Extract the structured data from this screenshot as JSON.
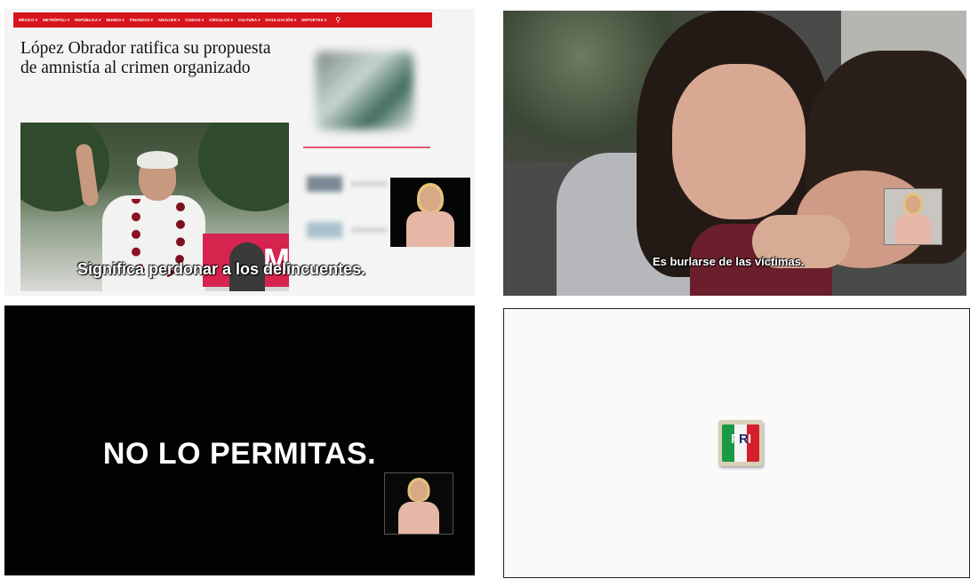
{
  "frame1": {
    "nav_items": [
      "MÉXICO ▾",
      "METRÓPOLI ▾",
      "REPÚBLICA ▾",
      "MUNDO ▾",
      "FINANZAS ▾",
      "ANÁLISIS ▾",
      "CIUDAD ▾",
      "CÍRCULOS ▾",
      "CULTURA ▾",
      "DIVULGACIÓN ▾",
      "DEPORTES ▾"
    ],
    "headline": "López Obrador ratifica su propuesta de amnistía al crimen organizado",
    "banner_text": "OM",
    "subtitle": "Significa perdonar a los delincuentes."
  },
  "frame2": {
    "subtitle": "Es burlarse de las víctimas."
  },
  "frame3": {
    "slogan": "NO LO PERMITAS."
  },
  "frame4": {
    "logo_letters": [
      "P",
      "R",
      "I"
    ]
  },
  "colors": {
    "nav_red": "#d8141c",
    "pri_green": "#1b9a45",
    "pri_red": "#d51f2c"
  }
}
